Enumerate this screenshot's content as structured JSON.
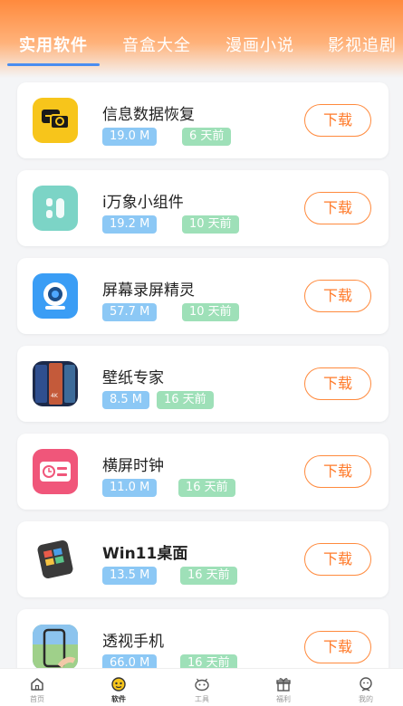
{
  "tabs": [
    {
      "label": "实用软件",
      "active": true
    },
    {
      "label": "音盒大全",
      "active": false
    },
    {
      "label": "漫画小说",
      "active": false
    },
    {
      "label": "影视追剧",
      "active": false
    }
  ],
  "apps": [
    {
      "name": "信息数据恢复",
      "size": "19.0 M",
      "time": "6 天前",
      "icon": "chat-recovery-icon",
      "icon_color": "#f7c51b"
    },
    {
      "name": "i万象小组件",
      "size": "19.2 M",
      "time": "10 天前",
      "icon": "widget-icon",
      "icon_color": "#7cd4c6"
    },
    {
      "name": "屏幕录屏精灵",
      "size": "57.7 M",
      "time": "10 天前",
      "icon": "camera-icon",
      "icon_color": "#3a9df5"
    },
    {
      "name": "壁纸专家",
      "size": "8.5 M",
      "time": "16 天前",
      "icon": "wallpaper-icon",
      "icon_color": "#1c2a4a"
    },
    {
      "name": "横屏时钟",
      "size": "11.0 M",
      "time": "16 天前",
      "icon": "clock-icon",
      "icon_color": "#f0567a"
    },
    {
      "name": "Win11桌面",
      "size": "13.5 M",
      "time": "16 天前",
      "icon": "win11-phone-icon",
      "icon_color": "#3a3a3a"
    },
    {
      "name": "透视手机",
      "size": "66.0 M",
      "time": "16 天前",
      "icon": "transparent-phone-icon",
      "icon_color": "#6bb0e0"
    }
  ],
  "download_label": "下载",
  "bottom_nav": [
    {
      "label": "首页",
      "icon": "home-icon",
      "active": false
    },
    {
      "label": "软件",
      "icon": "software-icon",
      "active": true
    },
    {
      "label": "工具",
      "icon": "tools-icon",
      "active": false
    },
    {
      "label": "福利",
      "icon": "gift-icon",
      "active": false
    },
    {
      "label": "我的",
      "icon": "profile-icon",
      "active": false
    }
  ],
  "colors": {
    "accent": "#ff8a3d",
    "size_badge": "#8cc8f5",
    "time_badge": "#9ee0b8",
    "tab_underline": "#4a8df0"
  }
}
